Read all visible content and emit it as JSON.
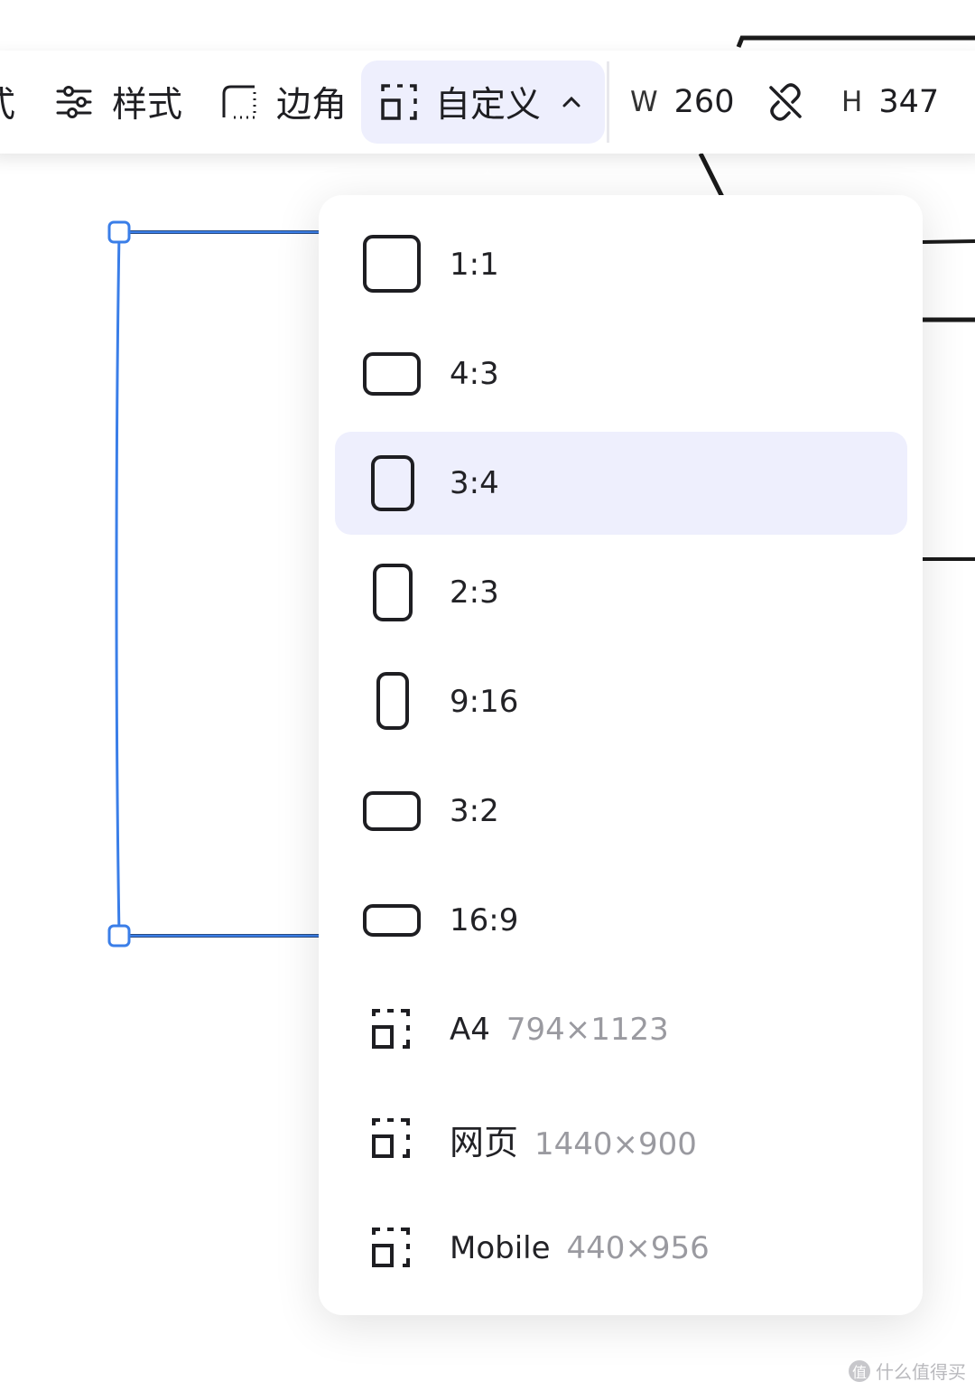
{
  "toolbar": {
    "edge_glyph": "式",
    "style_label": "样式",
    "corner_label": "边角",
    "custom_label": "自定义",
    "width_letter": "W",
    "width_value": "260",
    "height_letter": "H",
    "height_value": "347"
  },
  "dropdown": {
    "selected": "3:4",
    "items": [
      {
        "label": "1:1",
        "size": ""
      },
      {
        "label": "4:3",
        "size": ""
      },
      {
        "label": "3:4",
        "size": ""
      },
      {
        "label": "2:3",
        "size": ""
      },
      {
        "label": "9:16",
        "size": ""
      },
      {
        "label": "3:2",
        "size": ""
      },
      {
        "label": "16:9",
        "size": ""
      },
      {
        "label": "A4",
        "size": "794×1123"
      },
      {
        "label": "网页",
        "size": "1440×900"
      },
      {
        "label": "Mobile",
        "size": "440×956"
      }
    ]
  },
  "watermark": {
    "badge": "值",
    "text": "什么值得买"
  },
  "colors": {
    "accent": "#3a7ee8",
    "selected_bg": "#eeeffd",
    "stroke": "#1e1e22",
    "muted_text": "#9a9aa0"
  }
}
